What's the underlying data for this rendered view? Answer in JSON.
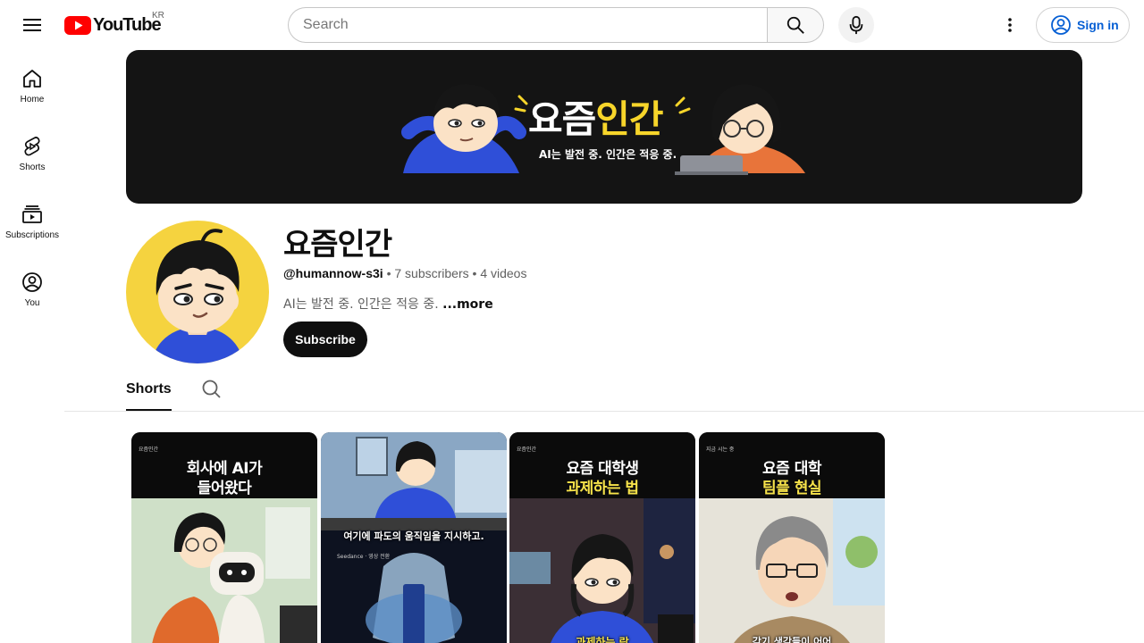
{
  "header": {
    "logo_text": "YouTube",
    "country_code": "KR",
    "search_placeholder": "Search",
    "signin_label": "Sign in"
  },
  "sidebar": {
    "items": [
      {
        "label": "Home",
        "icon": "home-icon"
      },
      {
        "label": "Shorts",
        "icon": "shorts-icon"
      },
      {
        "label": "Subscriptions",
        "icon": "subscriptions-icon"
      },
      {
        "label": "You",
        "icon": "you-icon"
      }
    ]
  },
  "banner": {
    "title_white": "요즘",
    "title_yellow": "인간",
    "tagline": "AI는 발전 중. 인간은 적응 중."
  },
  "channel": {
    "name": "요즘인간",
    "handle": "@humannow-s3i",
    "subscribers": "7 subscribers",
    "videos": "4 videos",
    "separator": "•",
    "description": "AI는 발전 중. 인간은 적응 중.",
    "more_label": "...more",
    "subscribe_label": "Subscribe"
  },
  "tabs": {
    "active": "Shorts"
  },
  "shorts": [
    {
      "brand": "요즘인간",
      "line1": "회사에 AI가",
      "line2": "들어왔다",
      "line1_color": "#ffffff",
      "line2_color": "#ffffff",
      "caption": ""
    },
    {
      "brand": "",
      "line1": "",
      "line2": "",
      "caption": "여기에 파도의 움직임을 지시하고.",
      "sub": "Seedance · 영상 전환"
    },
    {
      "brand": "요즘인간",
      "line1": "요즘 대학생",
      "line2": "과제하는 법",
      "line1_color": "#ffffff",
      "line2_color": "#f7e34a",
      "caption": "과제하는 락"
    },
    {
      "brand": "지금 시는 중",
      "line1": "요즘 대학",
      "line2": "팀플 현실",
      "line1_color": "#ffffff",
      "line2_color": "#f7e34a",
      "caption": "각기 생각들이 어어"
    }
  ],
  "colors": {
    "brand_red": "#ff0000",
    "link_blue": "#065fd4",
    "avatar_bg": "#f5d33f",
    "banner_bg": "#141414",
    "accent_yellow": "#f7d52a"
  }
}
